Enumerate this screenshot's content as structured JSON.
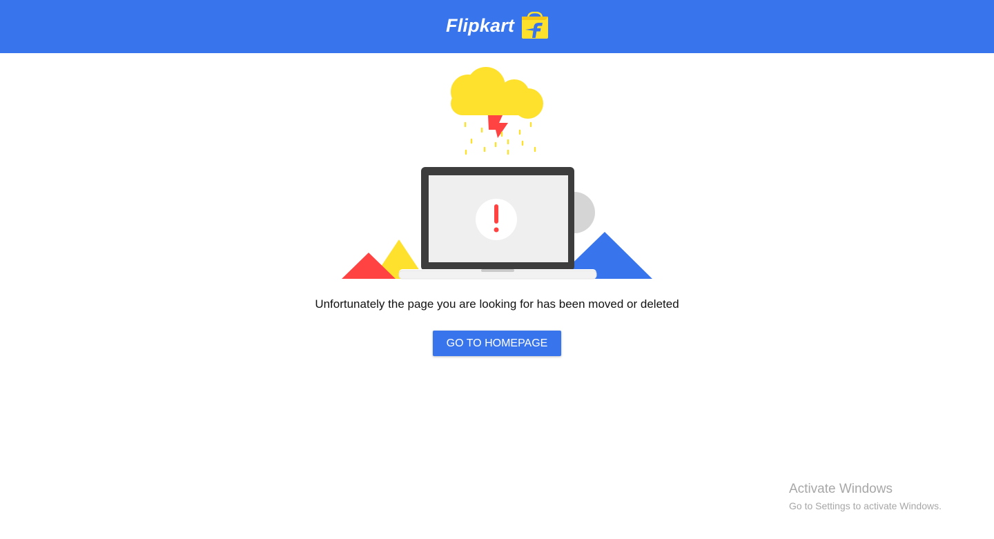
{
  "header": {
    "brand_name": "Flipkart",
    "logo_icon": "flipkart-bag-icon",
    "background_color": "#3874ec"
  },
  "illustration": {
    "icons": [
      "cloud-icon",
      "lightning-icon",
      "rain-icon",
      "laptop-icon",
      "exclamation-icon",
      "triangle-shapes"
    ],
    "colors": {
      "cloud": "#fde12d",
      "lightning": "#ff4343",
      "laptop_frame": "#3d3d3d",
      "screen": "#efefef",
      "alert": "#ff4343",
      "triangle_red": "#ff4343",
      "triangle_yellow": "#fde12d",
      "triangle_blue": "#3874ec",
      "circle_grey": "#d5d5d5"
    }
  },
  "main": {
    "message": "Unfortunately the page you are looking for has been moved or deleted",
    "home_button_label": "GO TO HOMEPAGE"
  },
  "watermark": {
    "title": "Activate Windows",
    "subtitle": "Go to Settings to activate Windows."
  }
}
